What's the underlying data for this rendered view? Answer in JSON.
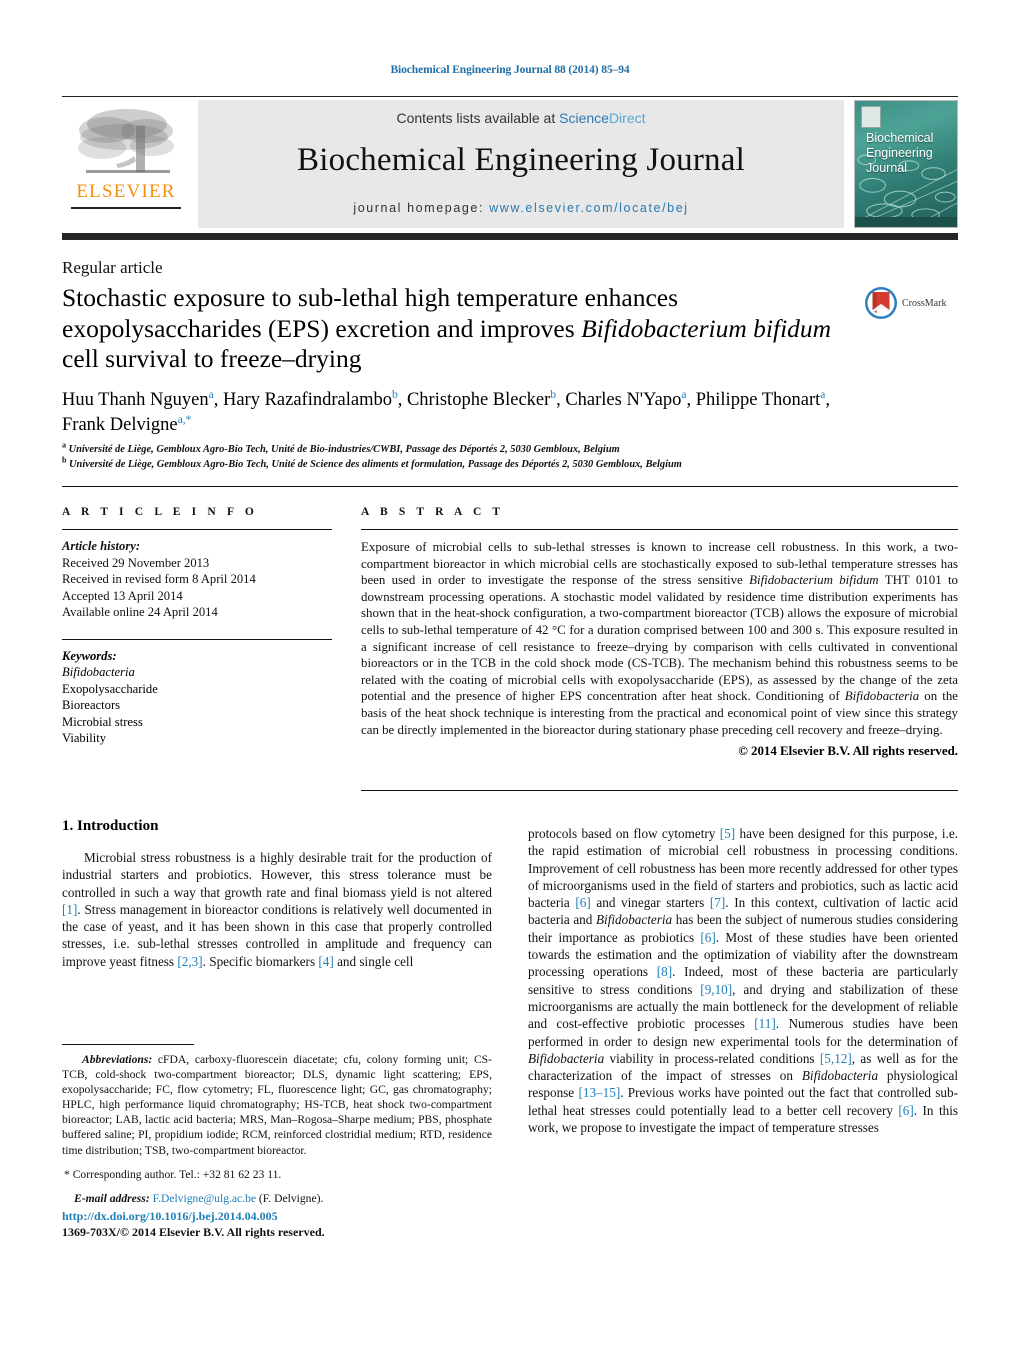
{
  "running_head": "Biochemical Engineering Journal 88 (2014) 85–94",
  "masthead": {
    "publisher_name": "ELSEVIER",
    "contents_prefix": "Contents lists available at ",
    "sciencedirect_a": "Science",
    "sciencedirect_b": "Direct",
    "journal_title": "Biochemical Engineering Journal",
    "homepage_label": "journal homepage: ",
    "homepage_url": "www.elsevier.com/locate/bej",
    "cover_title_line1": "Biochemical",
    "cover_title_line2": "Engineering",
    "cover_title_line3": "Journal"
  },
  "article": {
    "type": "Regular article",
    "crossmark_label": "CrossMark",
    "title_part1": "Stochastic exposure to sub-lethal high temperature enhances exopolysaccharides (EPS) excretion and improves ",
    "title_italic1": "Bifidobacterium bifidum",
    "title_part2": " cell survival to freeze–drying",
    "authors_line1_a": "Huu Thanh Nguyen",
    "authors_sup_a": "a",
    "authors_line1_b": ", Hary Razafindralambo",
    "authors_sup_b": "b",
    "authors_line1_c": ", Christophe Blecker",
    "authors_sup_c": "b",
    "authors_line1_d": ", Charles N'Yapo",
    "authors_sup_d": "a",
    "authors_line2_a": ", Philippe Thonart",
    "authors_sup_e": "a",
    "authors_line2_b": ", Frank Delvigne",
    "authors_sup_f": "a,*",
    "affiliation_a_marker": "a",
    "affiliation_a": " Université de Liège, Gembloux Agro-Bio Tech, Unité de Bio-industries/CWBI, Passage des Déportés 2, 5030 Gembloux, Belgium",
    "affiliation_b_marker": "b",
    "affiliation_b": " Université de Liège, Gembloux Agro-Bio Tech, Unité de Science des aliments et formulation, Passage des Déportés 2, 5030 Gembloux, Belgium"
  },
  "article_info": {
    "heading": "A R T I C L E  I N F O",
    "history_label": "Article history:",
    "history": [
      "Received 29 November 2013",
      "Received in revised form 8 April 2014",
      "Accepted 13 April 2014",
      "Available online 24 April 2014"
    ],
    "keywords_label": "Keywords:",
    "keywords": [
      "Bifidobacteria",
      "Exopolysaccharide",
      "Bioreactors",
      "Microbial stress",
      "Viability"
    ]
  },
  "abstract": {
    "heading": "A B S T R A C T",
    "p1": "Exposure of microbial cells to sub-lethal stresses is known to increase cell robustness. In this work, a two-compartment bioreactor in which microbial cells are stochastically exposed to sub-lethal temperature stresses has been used in order to investigate the response of the stress sensitive ",
    "ital1": "Bifidobacterium bifidum",
    "p2": " THT 0101 to downstream processing operations. A stochastic model validated by residence time distribution experiments has shown that in the heat-shock configuration, a two-compartment bioreactor (TCB) allows the exposure of microbial cells to sub-lethal temperature of 42 °C for a duration comprised between 100 and 300 s. This exposure resulted in a significant increase of cell resistance to freeze–drying by comparison with cells cultivated in conventional bioreactors or in the TCB in the cold shock mode (CS-TCB). The mechanism behind this robustness seems to be related with the coating of microbial cells with exopolysaccharide (EPS), as assessed by the change of the zeta potential and the presence of higher EPS concentration after heat shock. Conditioning of ",
    "ital2": "Bifidobacteria",
    "p3": " on the basis of the heat shock technique is interesting from the practical and economical point of view since this strategy can be directly implemented in the bioreactor during stationary phase preceding cell recovery and freeze–drying.",
    "copyright": "© 2014 Elsevier B.V. All rights reserved."
  },
  "introduction": {
    "heading": "1.  Introduction",
    "left_p1_a": "Microbial stress robustness is a highly desirable trait for the production of industrial starters and probiotics. However, this stress tolerance must be controlled in such a way that growth rate and final biomass yield is not altered ",
    "ref1": "[1]",
    "left_p1_b": ". Stress management in bioreactor conditions is relatively well documented in the case of yeast, and it has been shown in this case that properly controlled stresses, i.e. sub-lethal stresses controlled in amplitude and frequency can improve yeast fitness ",
    "ref23": "[2,3]",
    "left_p1_c": ". Specific biomarkers ",
    "ref4": "[4]",
    "left_p1_d": " and single cell",
    "right_a": "protocols based on flow cytometry ",
    "ref5": "[5]",
    "right_b": " have been designed for this purpose, i.e. the rapid estimation of microbial cell robustness in processing conditions. Improvement of cell robustness has been more recently addressed for other types of microorganisms used in the field of starters and probiotics, such as lactic acid bacteria ",
    "ref6a": "[6]",
    "right_c": " and vinegar starters ",
    "ref7": "[7]",
    "right_d": ". In this context, cultivation of lactic acid bacteria and ",
    "ital_bif1": "Bifidobacteria",
    "right_e": " has been the subject of numerous studies considering their importance as probiotics ",
    "ref6b": "[6]",
    "right_f": ". Most of these studies have been oriented towards the estimation and the optimization of viability after the downstream processing operations ",
    "ref8": "[8]",
    "right_g": ". Indeed, most of these bacteria are particularly sensitive to stress conditions ",
    "ref910": "[9,10]",
    "right_h": ", and drying and stabilization of these microorganisms are actually the main bottleneck for the development of reliable and cost-effective probiotic processes ",
    "ref11": "[11]",
    "right_i": ". Numerous studies have been performed in order to design new experimental tools for the determination of ",
    "ital_bif2": "Bifidobacteria",
    "right_j": " viability in process-related conditions ",
    "ref512": "[5,12]",
    "right_k": ", as well as for the characterization of the impact of stresses on ",
    "ital_bif3": "Bifidobacteria",
    "right_l": " physiological response ",
    "ref1315": "[13–15]",
    "right_m": ". Previous works have pointed out the fact that controlled sub-lethal heat stresses could potentially lead to a better cell recovery ",
    "ref6c": "[6]",
    "right_n": ". In this work, we propose to investigate the impact of temperature stresses"
  },
  "footnotes": {
    "abbrev_label": "Abbreviations:",
    "abbrev_text": "  cFDA, carboxy-fluorescein diacetate; cfu, colony forming unit; CS-TCB, cold-shock two-compartment bioreactor; DLS, dynamic light scattering; EPS, exopolysaccharide; FC, flow cytometry; FL, fluorescence light; GC, gas chromatography; HPLC, high performance liquid chromatography; HS-TCB, heat shock two-compartment bioreactor; LAB, lactic acid bacteria; MRS, Man–Rogosa–Sharpe medium; PBS, phosphate buffered saline; PI, propidium iodide; RCM, reinforced clostridial medium; RTD, residence time distribution; TSB, two-compartment bioreactor.",
    "corresponding_star": "*",
    "corresponding_text": " Corresponding author. Tel.: +32 81 62 23 11.",
    "email_label": "E-mail address:",
    "email_address": " F.Delvigne@ulg.ac.be",
    "email_suffix": " (F. Delvigne).",
    "doi_url": "http://dx.doi.org/10.1016/j.bej.2014.04.005",
    "issn_line": "1369-703X/© 2014 Elsevier B.V. All rights reserved."
  },
  "colors": {
    "link_blue": "#1f7fb8",
    "elsevier_orange": "#F29111",
    "band_grey": "#e8e8e8"
  }
}
